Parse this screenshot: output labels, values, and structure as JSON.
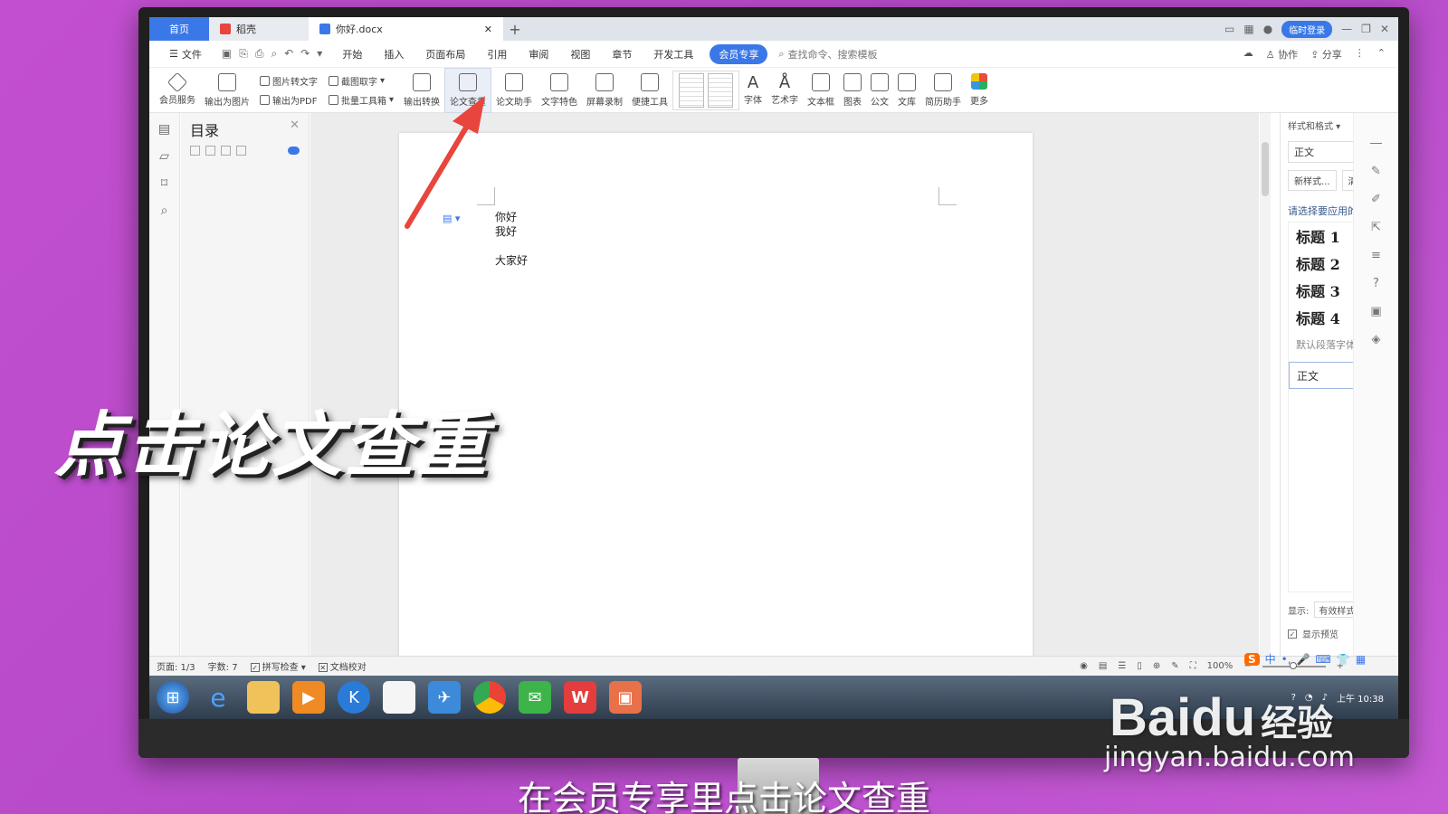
{
  "tabs": {
    "home": "首页",
    "daoke": "稻壳",
    "document": "你好.docx",
    "login": "临时登录"
  },
  "menu": {
    "file": "文件",
    "items": [
      "开始",
      "插入",
      "页面布局",
      "引用",
      "审阅",
      "视图",
      "章节",
      "开发工具"
    ],
    "member": "会员专享",
    "search": "查找命令、搜索模板",
    "collab": "协作",
    "share": "分享"
  },
  "ribbon": {
    "member_service": "会员服务",
    "export_image": "输出为图片",
    "pic_to_text": "图片转文字",
    "export_pdf": "输出为PDF",
    "screenshot_text": "截图取字",
    "batch_tools": "批量工具箱",
    "export_convert": "输出转换",
    "paper_check": "论文查重",
    "paper_assistant": "论文助手",
    "text_features": "文字特色",
    "screen_record": "屏幕录制",
    "quick_tools": "便捷工具",
    "font": "字体",
    "art_text": "艺术字",
    "textbox": "文本框",
    "chart": "图表",
    "official": "公文",
    "library": "文库",
    "resume": "简历助手",
    "more": "更多"
  },
  "toc": {
    "title": "目录"
  },
  "document": {
    "lines": [
      "你好",
      "我好",
      "大家好"
    ]
  },
  "style_pane": {
    "title": "样式和格式",
    "current": "正文",
    "new_style": "新样式...",
    "clear_format": "清除格式",
    "prompt": "请选择要应用的格式",
    "styles": [
      "标题 1",
      "标题 2",
      "标题 3",
      "标题 4"
    ],
    "default_font": "默认段落字体",
    "body": "正文",
    "show_label": "显示:",
    "show_value": "有效样式",
    "preview": "显示预览"
  },
  "status": {
    "page": "页面: 1/3",
    "words": "字数: 7",
    "spell": "拼写检查",
    "proof": "文档校对",
    "zoom": "100%"
  },
  "tray": {
    "time": "上午 10:38",
    "ime": "中"
  },
  "overlay": {
    "big_caption": "点击论文查重",
    "sub_caption": "在会员专享里点击论文查重",
    "wm_brand": "Bai",
    "wm_cn": "经验",
    "wm_url": "jingyan.baidu.com"
  },
  "colors": {
    "accent": "#3b78e7",
    "arrow": "#e8453c",
    "background": "#c34fd0"
  }
}
